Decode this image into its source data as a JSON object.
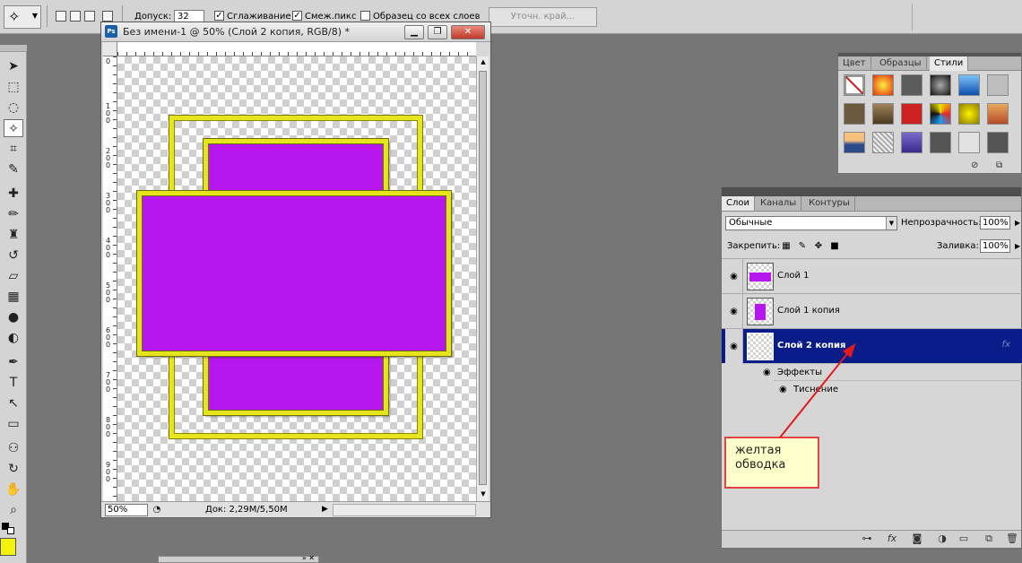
{
  "options_bar": {
    "tolerance_label": "Допуск:",
    "tolerance_value": "32",
    "antialias_label": "Сглаживание",
    "antialias_checked": "✓",
    "contiguous_label": "Смеж.пикс",
    "contiguous_checked": "✓",
    "sample_all_label": "Образец со всех слоев",
    "refine_edge_label": "Уточн. край..."
  },
  "document": {
    "title": "Без имени-1 @ 50% (Слой 2 копия, RGB/8) *",
    "badge": "Ps",
    "zoom": "50%",
    "doc_size": "Док: 2,29M/5,50M",
    "ruler_numbers": [
      "0",
      "1\n0\n0",
      "2\n0\n0",
      "3\n0\n0",
      "4\n0\n0",
      "5\n0\n0",
      "6\n0\n0",
      "7\n0\n0",
      "8\n0\n0",
      "9\n0\n0"
    ],
    "colors": {
      "fill": "#b517ee",
      "stroke": "#e7e51e"
    }
  },
  "styles_panel": {
    "tabs": [
      "Цвет",
      "Образцы",
      "Стили"
    ],
    "active_tab": "Стили"
  },
  "layers_panel": {
    "tabs": [
      "Слои",
      "Каналы",
      "Контуры"
    ],
    "blend_mode": "Обычные",
    "opacity_label": "Непрозрачность:",
    "opacity_value": "100%",
    "lock_label": "Закрепить:",
    "fill_label": "Заливка:",
    "fill_value": "100%",
    "layers": [
      {
        "name": "Слой 1",
        "selected": false
      },
      {
        "name": "Слой 1 копия",
        "selected": false
      },
      {
        "name": "Слой 2 копия",
        "selected": true,
        "fx": "fx"
      }
    ],
    "effects_label": "Эффекты",
    "effect_item": "Тиснение",
    "footer_icons": [
      "link-icon",
      "fx-icon",
      "mask-icon",
      "adjustment-icon",
      "group-icon",
      "new-layer-icon",
      "trash-icon"
    ]
  },
  "annotation": {
    "text_line1": "желтая",
    "text_line2": "обводка",
    "arrow_color": "#e21b1b"
  },
  "foreground_color": "#f2f20a"
}
